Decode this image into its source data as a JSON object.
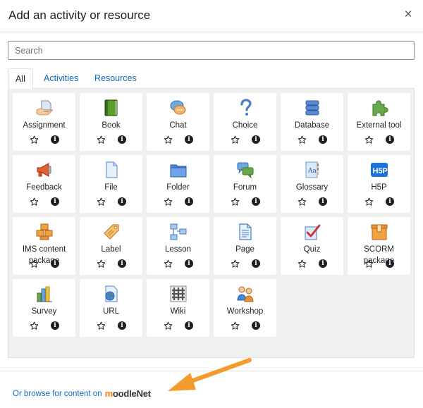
{
  "dialog": {
    "title": "Add an activity or resource",
    "close_label": "×"
  },
  "search": {
    "placeholder": "Search",
    "value": ""
  },
  "tabs": [
    {
      "label": "All",
      "active": true
    },
    {
      "label": "Activities",
      "active": false
    },
    {
      "label": "Resources",
      "active": false
    }
  ],
  "items": [
    {
      "label": "Assignment",
      "icon": "assignment-icon"
    },
    {
      "label": "Book",
      "icon": "book-icon"
    },
    {
      "label": "Chat",
      "icon": "chat-icon"
    },
    {
      "label": "Choice",
      "icon": "choice-icon"
    },
    {
      "label": "Database",
      "icon": "database-icon"
    },
    {
      "label": "External tool",
      "icon": "external-tool-icon"
    },
    {
      "label": "Feedback",
      "icon": "feedback-icon"
    },
    {
      "label": "File",
      "icon": "file-icon"
    },
    {
      "label": "Folder",
      "icon": "folder-icon"
    },
    {
      "label": "Forum",
      "icon": "forum-icon"
    },
    {
      "label": "Glossary",
      "icon": "glossary-icon"
    },
    {
      "label": "H5P",
      "icon": "h5p-icon"
    },
    {
      "label": "IMS content package",
      "icon": "ims-content-package-icon"
    },
    {
      "label": "Label",
      "icon": "label-icon"
    },
    {
      "label": "Lesson",
      "icon": "lesson-icon"
    },
    {
      "label": "Page",
      "icon": "page-icon"
    },
    {
      "label": "Quiz",
      "icon": "quiz-icon"
    },
    {
      "label": "SCORM package",
      "icon": "scorm-package-icon"
    },
    {
      "label": "Survey",
      "icon": "survey-icon"
    },
    {
      "label": "URL",
      "icon": "url-icon"
    },
    {
      "label": "Wiki",
      "icon": "wiki-icon"
    },
    {
      "label": "Workshop",
      "icon": "workshop-icon"
    }
  ],
  "footer": {
    "browse_text": "Or browse for content on",
    "brand_m": "m",
    "brand_rest": "oodleNet"
  },
  "colors": {
    "accent": "#0f6cbf",
    "arrow": "#f39c2b",
    "panel": "#f0f0f0"
  }
}
